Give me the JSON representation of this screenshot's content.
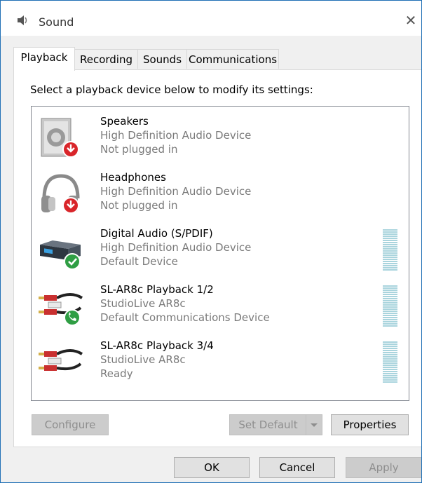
{
  "window": {
    "title": "Sound",
    "close_glyph": "✕"
  },
  "tabs": [
    {
      "label": "Playback",
      "active": true
    },
    {
      "label": "Recording",
      "active": false
    },
    {
      "label": "Sounds",
      "active": false
    },
    {
      "label": "Communications",
      "active": false
    }
  ],
  "instruction": "Select a playback device below to modify its settings:",
  "devices": [
    {
      "name": "Speakers",
      "driver": "High Definition Audio Device",
      "status": "Not plugged in",
      "icon": "speaker-icon",
      "badge": "red-down-arrow"
    },
    {
      "name": "Headphones",
      "driver": "High Definition Audio Device",
      "status": "Not plugged in",
      "icon": "headphones-icon",
      "badge": "red-down-arrow"
    },
    {
      "name": "Digital Audio (S/PDIF)",
      "driver": "High Definition Audio Device",
      "status": "Default Device",
      "icon": "digital-audio-icon",
      "badge": "green-check"
    },
    {
      "name": "SL-AR8c Playback 1/2",
      "driver": "StudioLive AR8c",
      "status": "Default Communications Device",
      "icon": "rca-cable-icon",
      "badge": "green-phone"
    },
    {
      "name": "SL-AR8c Playback 3/4",
      "driver": "StudioLive AR8c",
      "status": "Ready",
      "icon": "rca-cable-icon",
      "badge": "none"
    }
  ],
  "buttons": {
    "configure": "Configure",
    "set_default": "Set Default",
    "properties": "Properties",
    "ok": "OK",
    "cancel": "Cancel",
    "apply": "Apply"
  },
  "colors": {
    "window_border": "#1f6fb5",
    "meter": "#a9d4dd",
    "badge_red": "#d9252a",
    "badge_green": "#2f9e44"
  }
}
